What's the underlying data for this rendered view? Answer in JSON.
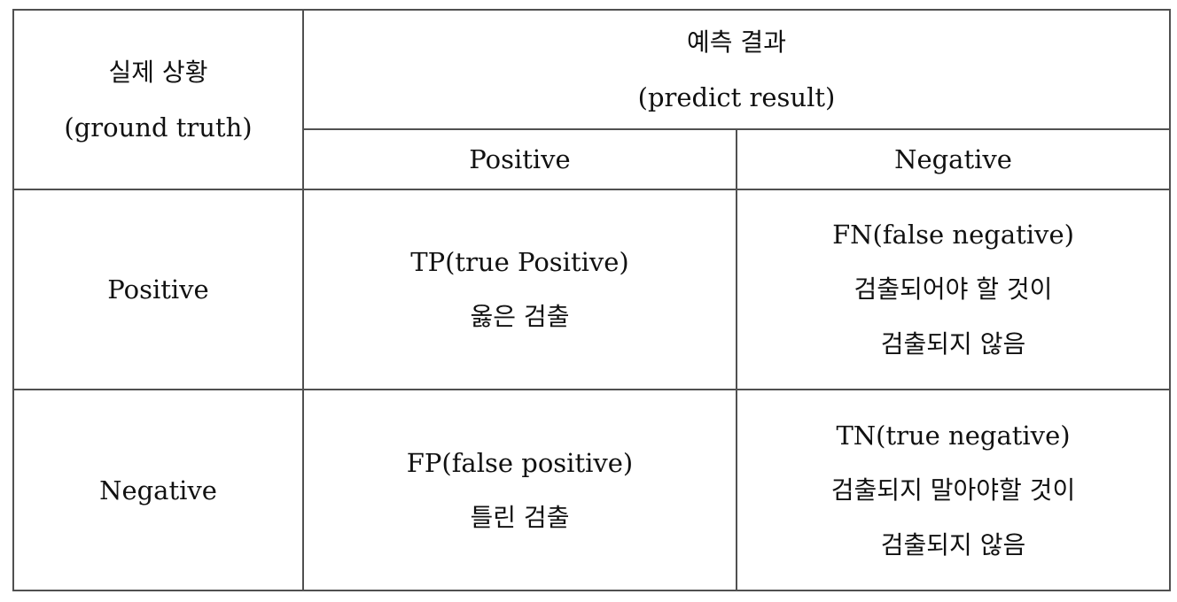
{
  "table": {
    "corner_header": {
      "line1": "실제 상황",
      "line2": "(ground truth)"
    },
    "predict_header": {
      "line1": "예측 결과",
      "line2": "(predict result)"
    },
    "predict_columns": [
      "Positive",
      "Negative"
    ],
    "rows": [
      {
        "label": "Positive",
        "cells": [
          {
            "lines": [
              "TP(true Positive)",
              "옳은 검출"
            ]
          },
          {
            "lines": [
              "FN(false negative)",
              "검출되어야 할 것이",
              "검출되지 않음"
            ]
          }
        ]
      },
      {
        "label": "Negative",
        "cells": [
          {
            "lines": [
              "FP(false positive)",
              "틀린 검출"
            ]
          },
          {
            "lines": [
              "TN(true negative)",
              "검출되지 말아야할 것이",
              "검출되지 않음"
            ]
          }
        ]
      }
    ]
  }
}
